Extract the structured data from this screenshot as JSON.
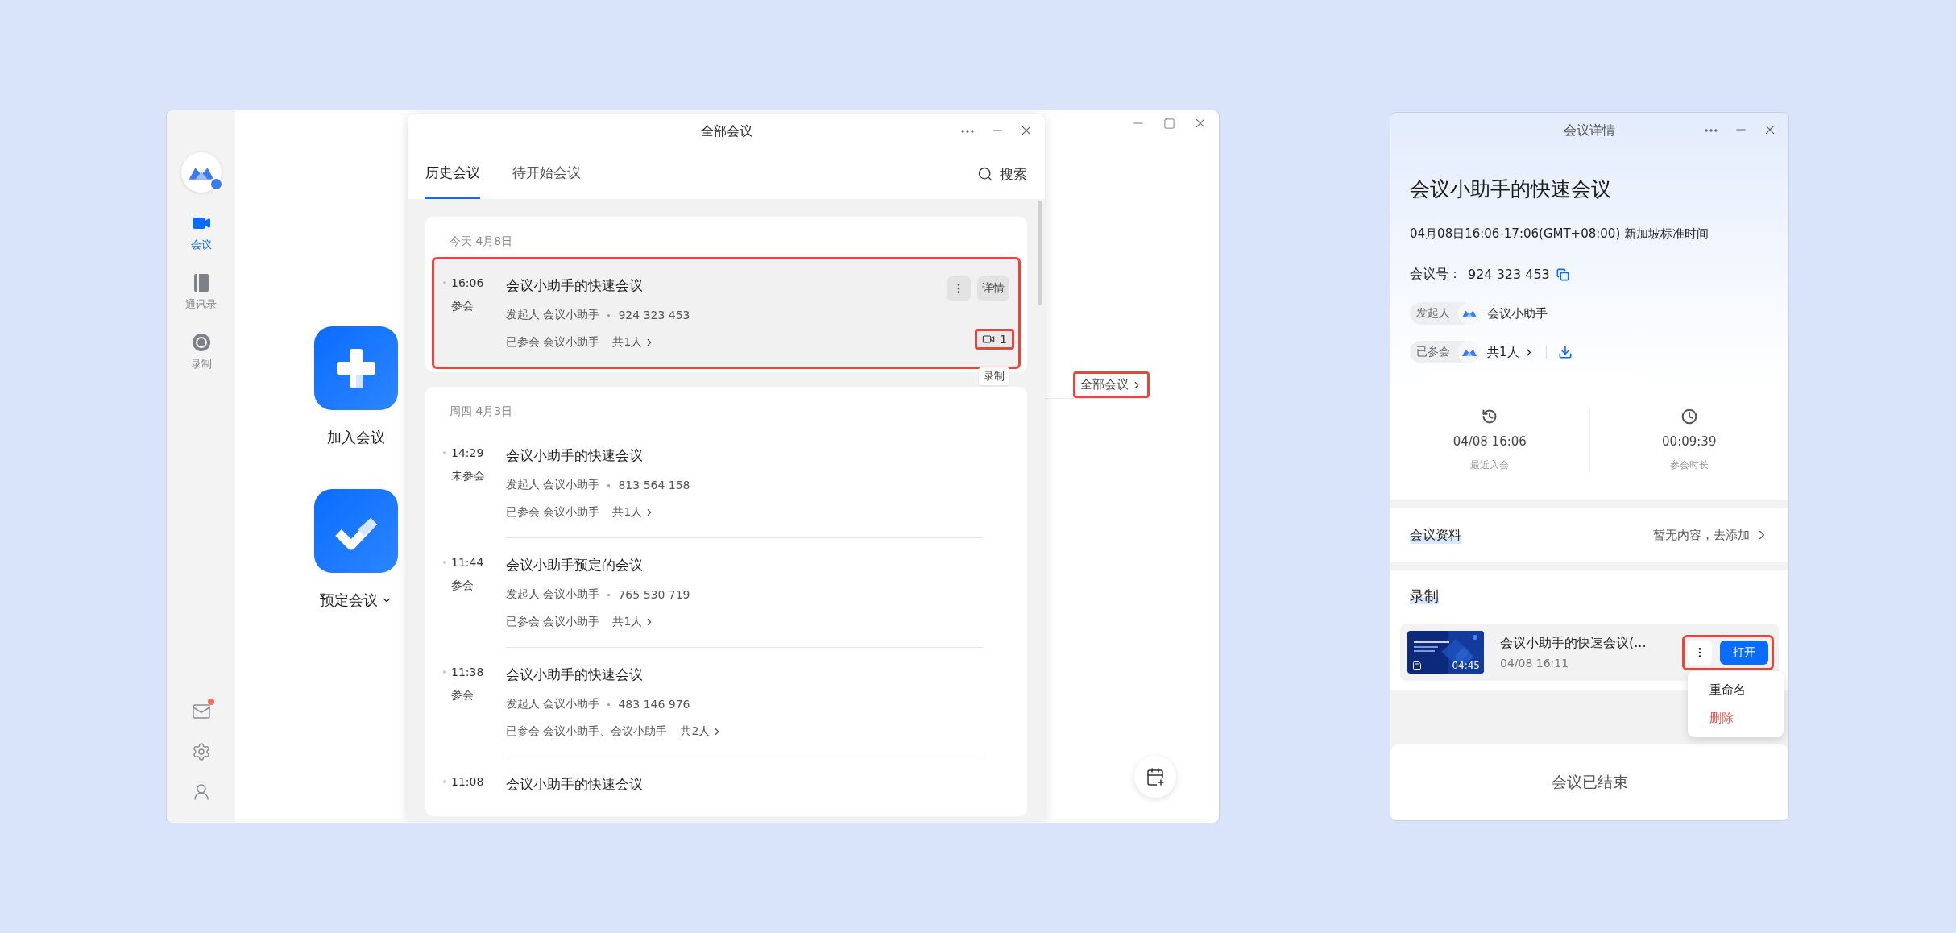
{
  "main_window": {
    "sidebar": {
      "items": [
        {
          "label": "会议",
          "kind": "video",
          "selected": true
        },
        {
          "label": "通讯录",
          "kind": "contacts",
          "selected": false
        },
        {
          "label": "录制",
          "kind": "record",
          "selected": false
        }
      ],
      "mail_unread": true
    },
    "actions": [
      {
        "label": "加入会议",
        "kind": "join",
        "dropdown": false
      },
      {
        "label": "预定会议",
        "kind": "schedule",
        "dropdown": true
      }
    ],
    "all_meetings_link": {
      "label": "全部会议",
      "highlighted": true
    }
  },
  "meetings_popup": {
    "title": "全部会议",
    "tabs": [
      {
        "label": "历史会议",
        "selected": true
      },
      {
        "label": "待开始会议",
        "selected": false
      }
    ],
    "search": "搜索",
    "groups": [
      {
        "date": "今天 4月8日",
        "meetings": [
          {
            "time": "16:06",
            "status": "参会",
            "title": "会议小助手的快速会议",
            "host": "发起人 会议小助手",
            "number": "924 323 453",
            "attendees": "已参会 会议小助手",
            "count": "共1人",
            "selected": true,
            "highlighted": true,
            "details": "详情",
            "recordings": "1",
            "recordings_highlighted": true,
            "tooltip": "录制"
          }
        ]
      },
      {
        "date": "周四 4月3日",
        "meetings": [
          {
            "time": "14:29",
            "status": "未参会",
            "title": "会议小助手的快速会议",
            "host": "发起人 会议小助手",
            "number": "813 564 158",
            "attendees": "已参会 会议小助手",
            "count": "共1人",
            "selected": false,
            "highlighted": false
          },
          {
            "time": "11:44",
            "status": "参会",
            "title": "会议小助手预定的会议",
            "host": "发起人 会议小助手",
            "number": "765 530 719",
            "attendees": "已参会 会议小助手",
            "count": "共1人",
            "selected": false,
            "highlighted": false
          },
          {
            "time": "11:38",
            "status": "参会",
            "title": "会议小助手的快速会议",
            "host": "发起人 会议小助手",
            "number": "483 146 976",
            "attendees": "已参会 会议小助手、会议小助手",
            "count": "共2人",
            "selected": false,
            "highlighted": false
          },
          {
            "time": "11:08",
            "title": "会议小助手的快速会议",
            "selected": false,
            "highlighted": false
          }
        ]
      }
    ]
  },
  "detail_window": {
    "title": "会议详情",
    "meeting_title": "会议小助手的快速会议",
    "time": "04月08日16:06-17:06(GMT+08:00) 新加坡标准时间",
    "number_label": "会议号：",
    "number": "924 323 453",
    "host_label": "发起人",
    "host": "会议小助手",
    "attended_label": "已参会",
    "attended": "共1人",
    "stats": [
      {
        "kind": "history",
        "value": "04/08 16:06",
        "label": "最近入会"
      },
      {
        "kind": "clock",
        "value": "00:09:39",
        "label": "参会时长"
      }
    ],
    "materials": {
      "label": "会议资料",
      "action": "暂无内容，去添加"
    },
    "recording_section": "录制",
    "recordings": [
      {
        "title": "会议小助手的快速会议(...",
        "date": "04/08 16:11",
        "duration": "04:45",
        "open": "打开",
        "highlighted": true
      }
    ],
    "menu": [
      {
        "label": "重命名",
        "kind": "normal"
      },
      {
        "label": "删除",
        "kind": "danger"
      }
    ],
    "footer": "会议已结束"
  }
}
